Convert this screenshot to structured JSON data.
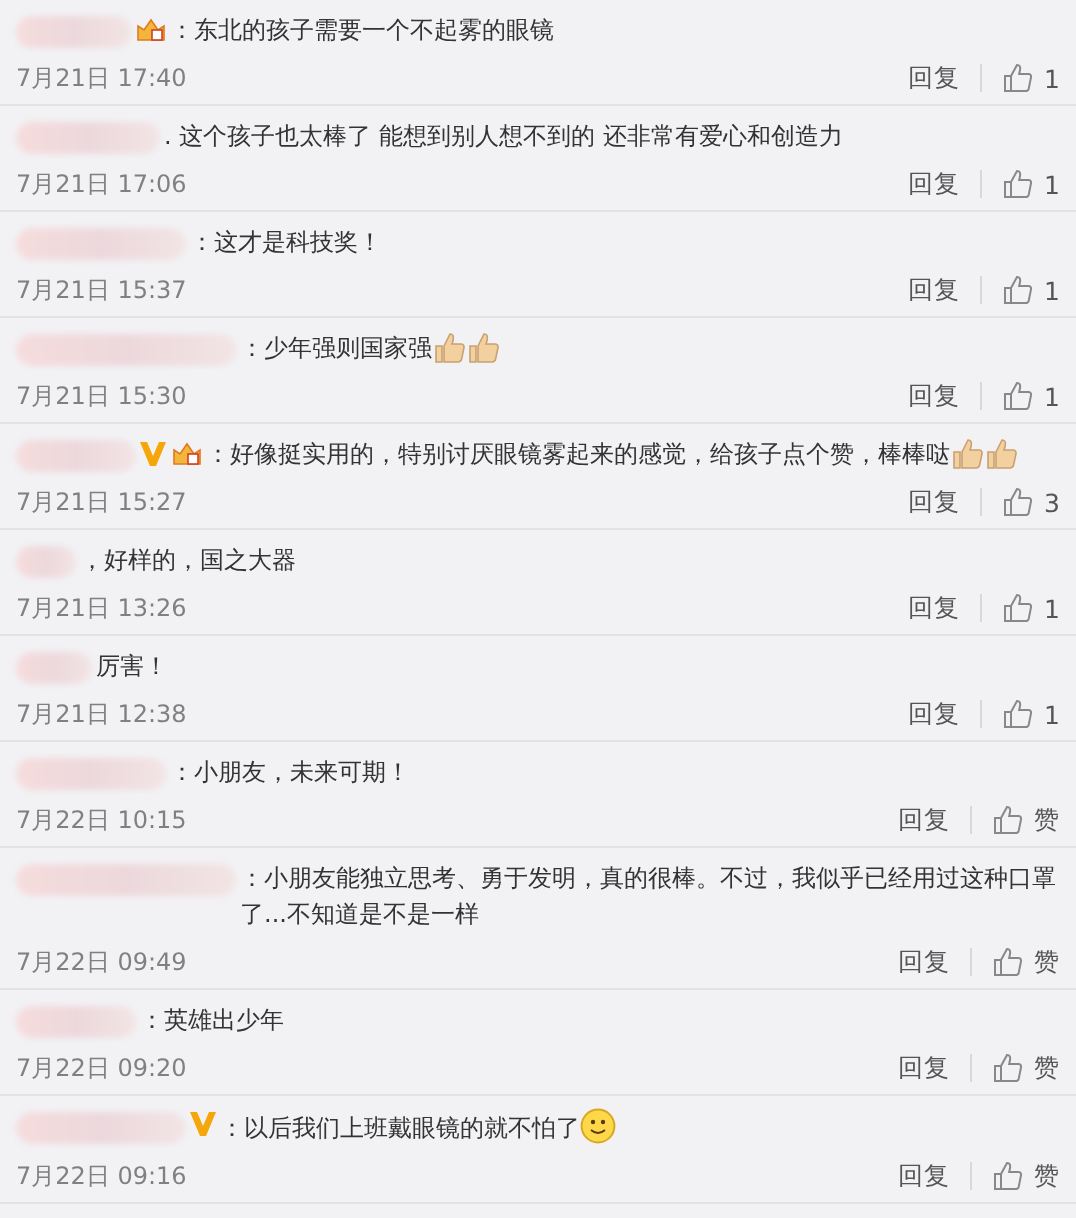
{
  "comments": [
    {
      "verified": false,
      "vip": true,
      "text": "：东北的孩子需要一个不起雾的眼镜",
      "time": "7月21日 17:40",
      "reply": "回复",
      "likes": "1"
    },
    {
      "verified": false,
      "vip": false,
      "text": ". 这个孩子也太棒了 能想到别人想不到的 还非常有爱心和创造力",
      "time": "7月21日 17:06",
      "reply": "回复",
      "likes": "1"
    },
    {
      "verified": false,
      "vip": false,
      "text": "：这才是科技奖！",
      "time": "7月21日 15:37",
      "reply": "回复",
      "likes": "1"
    },
    {
      "verified": false,
      "vip": false,
      "text": "：少年强则国家强",
      "emojis": [
        {
          "kind": "thumbs-up"
        },
        {
          "kind": "thumbs-up"
        }
      ],
      "time": "7月21日 15:30",
      "reply": "回复",
      "likes": "1"
    },
    {
      "verified": true,
      "vip": true,
      "text": "：好像挺实用的，特别讨厌眼镜雾起来的感觉，给孩子点个赞，棒棒哒",
      "emojis": [
        {
          "kind": "thumbs-up"
        },
        {
          "kind": "thumbs-up"
        }
      ],
      "time": "7月21日 15:27",
      "reply": "回复",
      "likes": "3"
    },
    {
      "verified": false,
      "vip": false,
      "text": "，好样的，国之大器",
      "time": "7月21日 13:26",
      "reply": "回复",
      "likes": "1"
    },
    {
      "verified": false,
      "vip": false,
      "text": "厉害！",
      "time": "7月21日 12:38",
      "reply": "回复",
      "likes": "1"
    },
    {
      "verified": false,
      "vip": false,
      "text": "：小朋友，未来可期！",
      "time": "7月22日 10:15",
      "reply": "回复",
      "likes": "赞"
    },
    {
      "verified": false,
      "vip": false,
      "text": "：小朋友能独立思考、勇于发明，真的很棒。不过，我似乎已经用过这种口罩了...不知道是不是一样",
      "time": "7月22日 09:49",
      "reply": "回复",
      "likes": "赞"
    },
    {
      "verified": false,
      "vip": false,
      "text": "：英雄出少年",
      "time": "7月22日 09:20",
      "reply": "回复",
      "likes": "赞"
    },
    {
      "verified": true,
      "vip": false,
      "text": "：以后我们上班戴眼镜的就不怕了",
      "emojis": [
        {
          "kind": "smile"
        }
      ],
      "time": "7月22日 09:16",
      "reply": "回复",
      "likes": "赞"
    }
  ]
}
